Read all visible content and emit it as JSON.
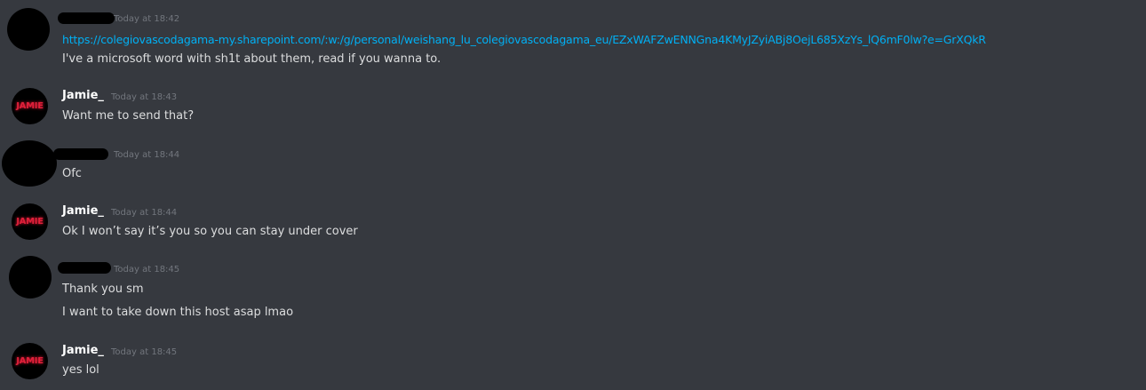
{
  "messages": [
    {
      "author": "",
      "timestamp": "Today at 18:42",
      "link": "https://colegiovascodagama-my.sharepoint.com/:w:/g/personal/weishang_lu_colegiovascodagama_eu/EZxWAFZwENNGna4KMyJZyiABj8OejL685XzYs_lQ6mF0lw?e=GrXQkR",
      "lines": [
        "I've a microsoft word with sh1t about them, read if you wanna to."
      ]
    },
    {
      "author": "Jamie_",
      "avatar_text": "JAMIE",
      "timestamp": "Today at 18:43",
      "lines": [
        "Want me to send that?"
      ]
    },
    {
      "author": "",
      "timestamp": "Today at 18:44",
      "lines": [
        "Ofc"
      ]
    },
    {
      "author": "Jamie_",
      "avatar_text": "JAMIE",
      "timestamp": "Today at 18:44",
      "lines": [
        "Ok I won’t say it’s you so you can stay under cover"
      ]
    },
    {
      "author": "",
      "timestamp": "Today at 18:45",
      "lines": [
        "Thank you sm",
        "I want to take down this host asap lmao"
      ]
    },
    {
      "author": "Jamie_",
      "avatar_text": "JAMIE",
      "timestamp": "Today at 18:45",
      "lines": [
        "yes lol"
      ]
    }
  ],
  "colors": {
    "background": "#36393f",
    "link": "#00b0f4",
    "text": "#dcddde",
    "timestamp": "#72767d",
    "jamie_avatar_text": "#e0203a"
  }
}
